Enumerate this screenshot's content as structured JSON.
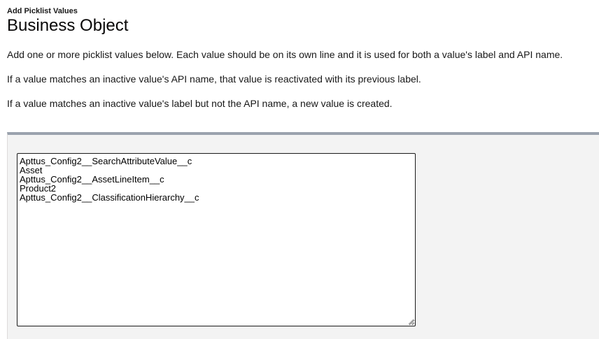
{
  "header": {
    "subtitle": "Add Picklist Values",
    "title": "Business Object"
  },
  "instructions": [
    "Add one or more picklist values below. Each value should be on its own line and it is used for both a value's label and API name.",
    "If a value matches an inactive value's API name, that value is reactivated with its previous label.",
    "If a value matches an inactive value's label but not the API name, a new value is created."
  ],
  "values_textarea": {
    "lines": [
      "Apttus_Config2__SearchAttributeValue__c",
      "Asset",
      "Apttus_Config2__AssetLineItem__c",
      "Product2",
      "Apttus_Config2__ClassificationHierarchy__c"
    ]
  },
  "icons": {
    "resize": "resize-grip-icon"
  }
}
